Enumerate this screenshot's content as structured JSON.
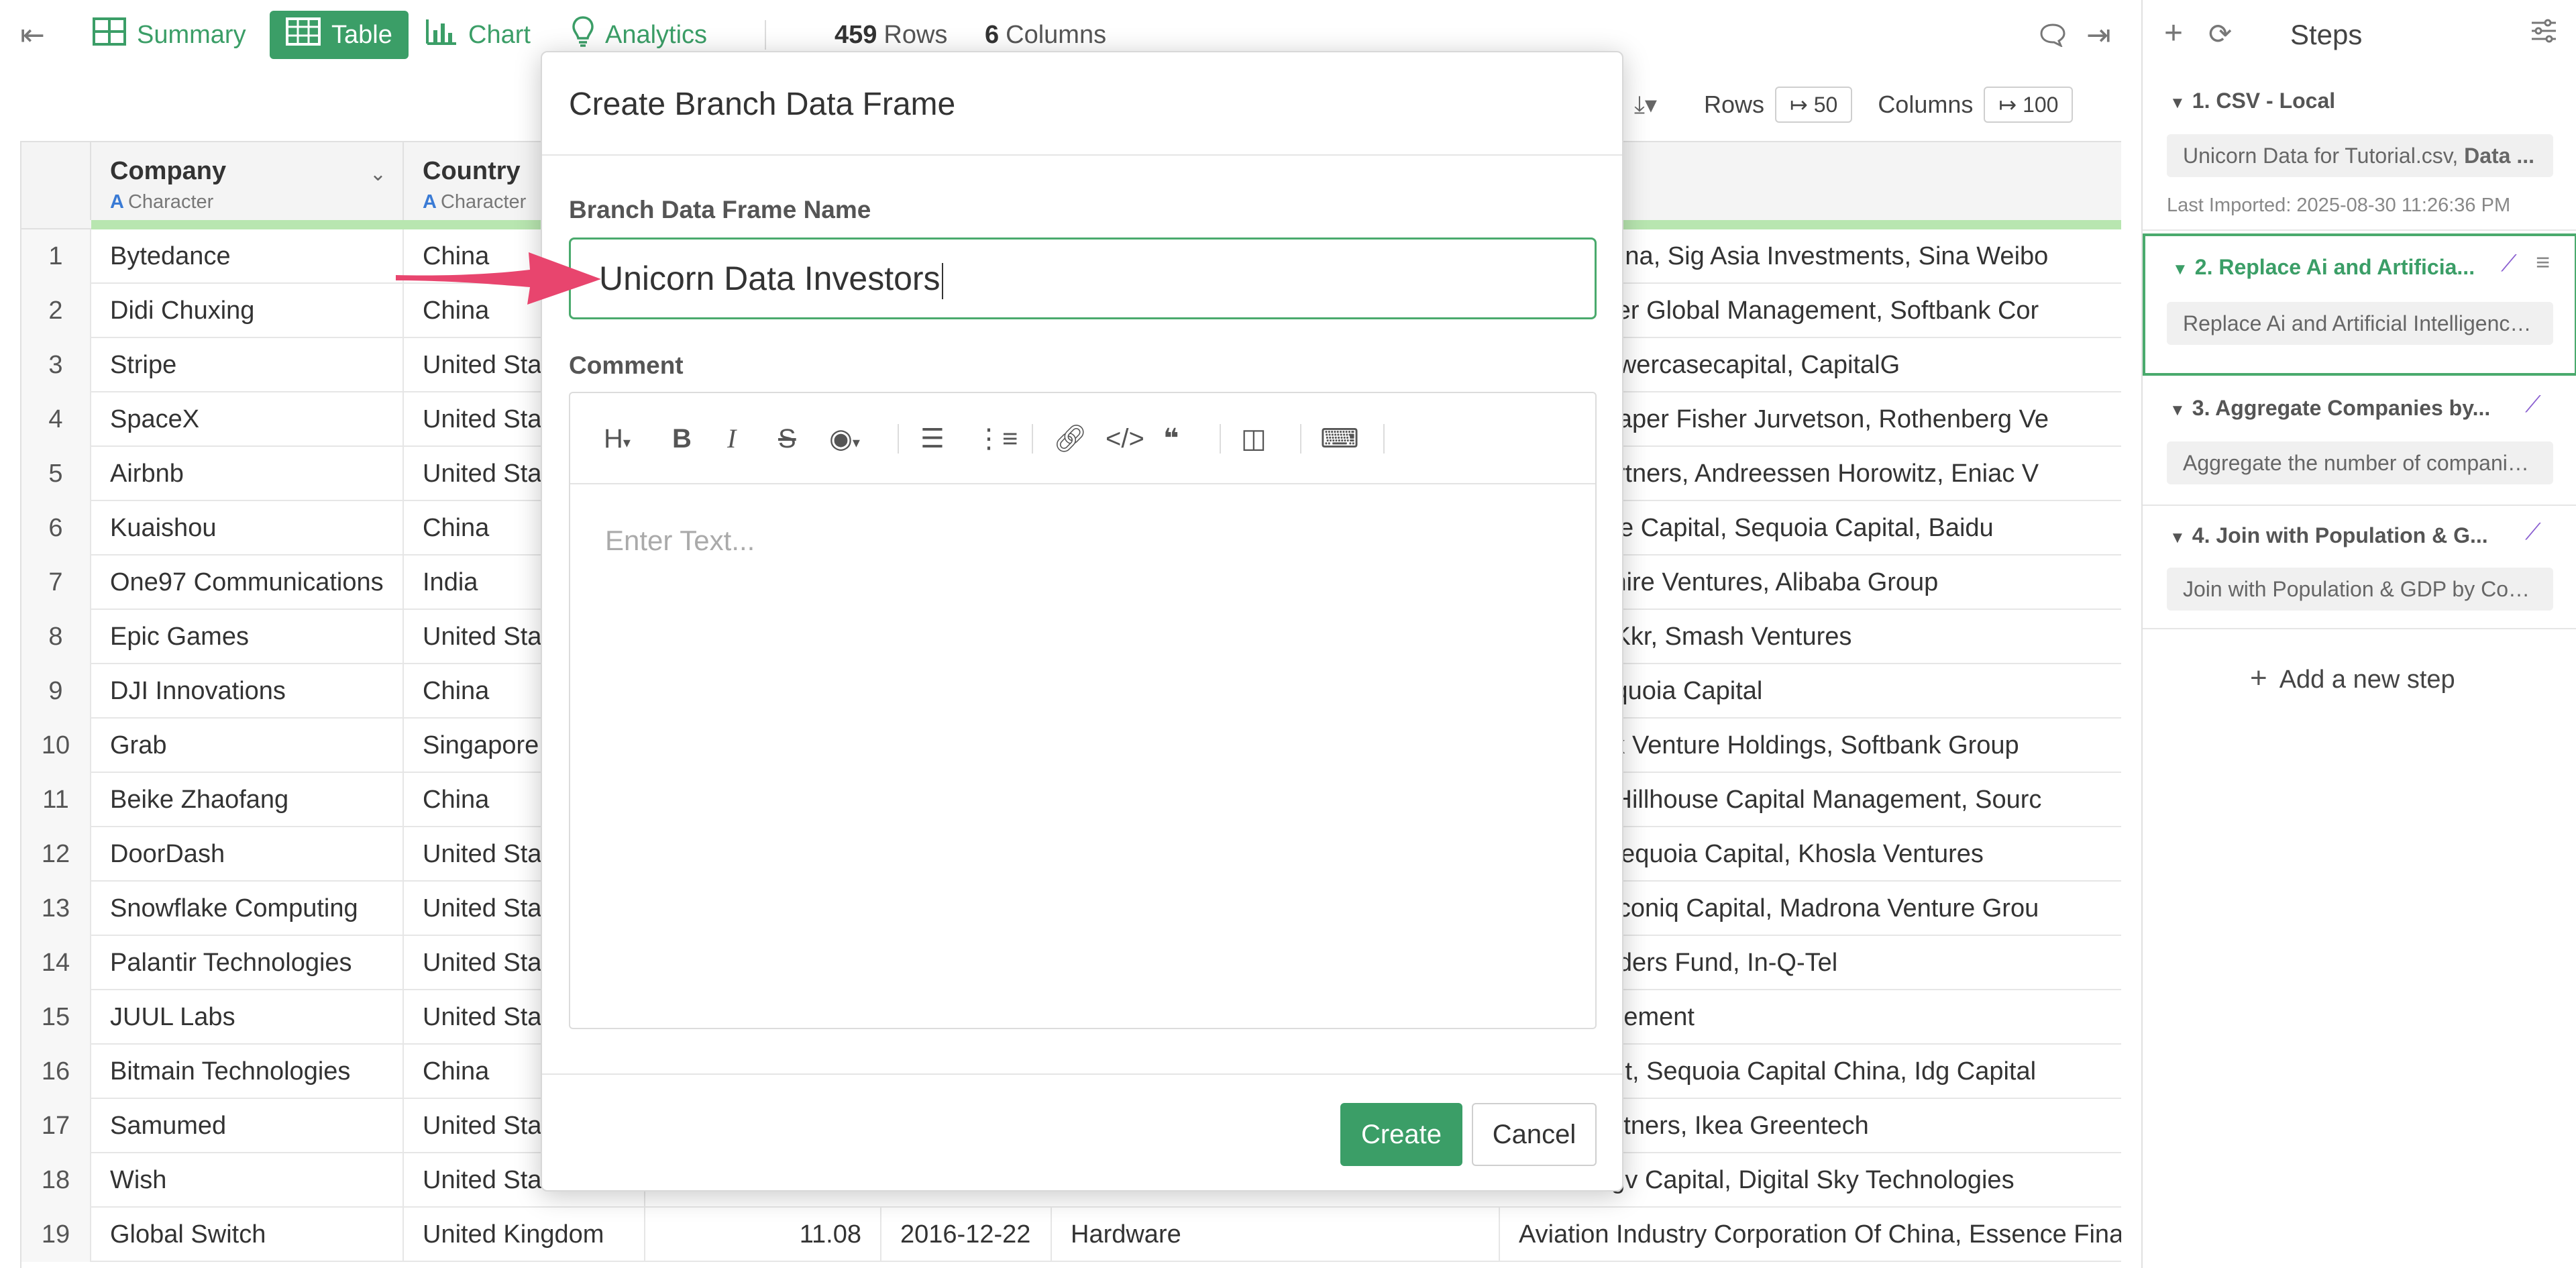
{
  "toolbar": {
    "summary": "Summary",
    "table": "Table",
    "chart": "Chart",
    "analytics": "Analytics",
    "rows_count": "459",
    "rows_label": "Rows",
    "cols_count": "6",
    "cols_label": "Columns"
  },
  "subtoolbar": {
    "rows_label": "Rows",
    "rows_value": "↦ 50",
    "cols_label": "Columns",
    "cols_value": "↦ 100"
  },
  "table": {
    "columns": [
      {
        "name": "Company",
        "type": "Character"
      },
      {
        "name": "Country",
        "type": "Character"
      }
    ],
    "rows": [
      {
        "n": "1",
        "company": "Bytedance",
        "country": "China",
        "investors": "apital China, Sig Asia Investments, Sina Weibo"
      },
      {
        "n": "2",
        "company": "Didi Chuxing",
        "country": "China",
        "investors": "ners, Tiger Global Management, Softbank Cor"
      },
      {
        "n": "3",
        "company": "Stripe",
        "country": "United States",
        "investors": "tures, Lowercasecapital, CapitalG"
      },
      {
        "n": "4",
        "company": "SpaceX",
        "country": "United States",
        "investors": "Fund, Draper Fisher Jurvetson, Rothenberg Ve"
      },
      {
        "n": "5",
        "company": "Airbnb",
        "country": "United States",
        "investors": "talyst Partners, Andreessen Horowitz, Eniac V"
      },
      {
        "n": "6",
        "company": "Kuaishou",
        "country": "China",
        "investors": "le Venture Capital, Sequoia Capital, Baidu"
      },
      {
        "n": "7",
        "company": "One97 Communications",
        "country": "India",
        "investors": "al, Sapphire Ventures, Alibaba Group"
      },
      {
        "n": "8",
        "company": "Epic Games",
        "country": "United States",
        "investors": "oldings, Kkr, Smash Ventures"
      },
      {
        "n": "9",
        "company": "DJI Innovations",
        "country": "China",
        "investors": "ners, Sequoia Capital"
      },
      {
        "n": "10",
        "company": "Grab",
        "country": "Singapore",
        "investors": "al, Vertex Venture Holdings, Softbank Group"
      },
      {
        "n": "11",
        "company": "Beike Zhaofang",
        "country": "China",
        "investors": "oldings, Hillhouse Capital Management, Sourc"
      },
      {
        "n": "12",
        "company": "DoorDash",
        "country": "United States",
        "investors": "Group, Sequoia Capital, Khosla Ventures"
      },
      {
        "n": "13",
        "company": "Snowflake Computing",
        "country": "United States",
        "investors": "entures,Iconiq Capital, Madrona Venture Grou"
      },
      {
        "n": "14",
        "company": "Palantir Technologies",
        "country": "United States",
        "investors": "es, Founders Fund, In-Q-Tel"
      },
      {
        "n": "15",
        "company": "JUUL Labs",
        "country": "United States",
        "investors": "al Management"
      },
      {
        "n": "16",
        "company": "Bitmain Technologies",
        "country": "China",
        "investors": "nagement, Sequoia Capital China, Idg Capital"
      },
      {
        "n": "17",
        "company": "Samumed",
        "country": "United States",
        "investors": "nture Partners, Ikea Greentech"
      },
      {
        "n": "18",
        "company": "Wish",
        "country": "United States",
        "investors": "Fund, Ggv Capital, Digital Sky Technologies"
      },
      {
        "n": "19",
        "company": "Global Switch",
        "country": "United Kingdom",
        "valuation": "11.08",
        "date": "2016-12-22",
        "industry": "Hardware",
        "investors": "Aviation Industry Corporation Of China, Essence Financial"
      }
    ]
  },
  "steps": {
    "title": "Steps",
    "items": [
      {
        "title": "1. CSV - Local",
        "desc_prefix": "Unicorn Data for Tutorial.csv, ",
        "desc_bold": "Data ...",
        "meta": "Last Imported: 2025-08-30 11:26:36 PM"
      },
      {
        "title": "2. Replace Ai and Artificia...",
        "desc": "Replace Ai and Artificial Intelligence..."
      },
      {
        "title": "3. Aggregate Companies by...",
        "desc": "Aggregate the number of companie..."
      },
      {
        "title": "4. Join with Population & G...",
        "desc": "Join with Population & GDP by Cou..."
      }
    ],
    "add_step": "Add a new step"
  },
  "dialog": {
    "title": "Create Branch Data Frame",
    "name_label": "Branch Data Frame Name",
    "name_value": "Unicorn Data Investors",
    "comment_label": "Comment",
    "comment_placeholder": "Enter Text...",
    "create": "Create",
    "cancel": "Cancel"
  },
  "colors": {
    "accent": "#3b9e67",
    "arrow": "#e8456e",
    "wand": "#8a5fd0"
  }
}
